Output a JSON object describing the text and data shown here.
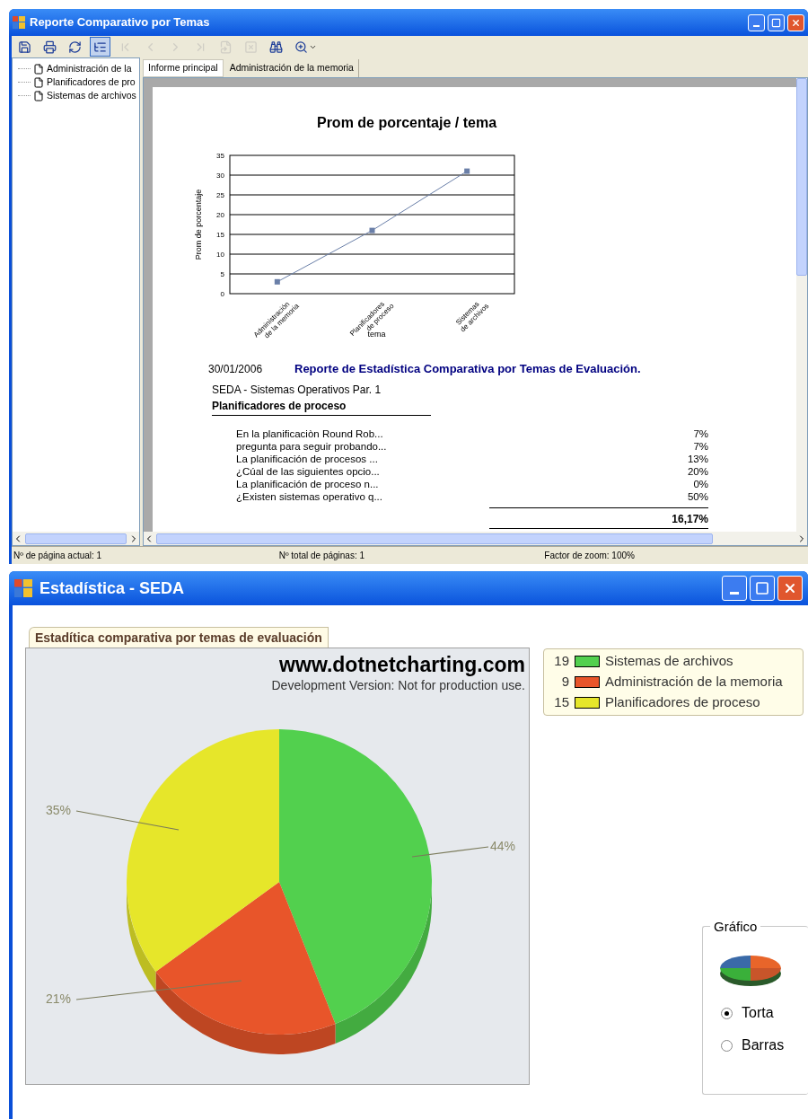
{
  "report_window": {
    "title": "Reporte Comparativo por Temas",
    "toolbar": [
      {
        "kind": "export",
        "disabled": false,
        "selected": false
      },
      {
        "kind": "print",
        "disabled": false,
        "selected": false
      },
      {
        "kind": "refresh",
        "disabled": false,
        "selected": false
      },
      {
        "kind": "tree",
        "disabled": false,
        "selected": true
      },
      {
        "kind": "first",
        "disabled": true,
        "selected": false
      },
      {
        "kind": "previous",
        "disabled": true,
        "selected": false
      },
      {
        "kind": "next",
        "disabled": true,
        "selected": false
      },
      {
        "kind": "last",
        "disabled": true,
        "selected": false
      },
      {
        "kind": "goto",
        "disabled": true,
        "selected": false
      },
      {
        "kind": "stop",
        "disabled": true,
        "selected": false
      },
      {
        "kind": "find",
        "disabled": false,
        "selected": false
      },
      {
        "kind": "zoom",
        "disabled": false,
        "selected": false
      }
    ],
    "tree": [
      {
        "label": "Administración de la"
      },
      {
        "label": "Planificadores de pro"
      },
      {
        "label": "Sistemas de archivos"
      }
    ],
    "tabs": [
      {
        "label": "Informe principal",
        "selected": true
      },
      {
        "label": "Administración de la memoria",
        "selected": false
      }
    ],
    "page": {
      "chart_data": {
        "type": "line",
        "title": "Prom de porcentaje / tema",
        "xlabel": "tema",
        "ylabel": "Prom de porcentaje",
        "categories": [
          "Administración de la memoria",
          "Planificadores de proceso",
          "Sistemas de archivos"
        ],
        "series": [
          {
            "color": "#6a7fa8",
            "marker": "square",
            "values": [
              3,
              16,
              31
            ]
          }
        ],
        "grid": true,
        "ylim": [
          0,
          35
        ],
        "yticks": [
          0,
          5,
          10,
          15,
          20,
          25,
          30,
          35
        ]
      },
      "date": "30/01/2006",
      "heading": "Reporte de Estadística Comparativa  por Temas de Evaluación.",
      "subtitle": "SEDA  - Sistemas Operativos Par. 1",
      "group": "Planificadores de proceso",
      "rows": [
        {
          "question": "En la planificaciòn Round Rob...",
          "percent": "7%"
        },
        {
          "question": "pregunta para seguir probando...",
          "percent": "7%"
        },
        {
          "question": "La planificación de procesos ...",
          "percent": "13%"
        },
        {
          "question": "¿Cúal de las siguientes opcio...",
          "percent": "20%"
        },
        {
          "question": "La planificación de proceso n...",
          "percent": "0%"
        },
        {
          "question": "¿Existen sistemas operativo q...",
          "percent": "50%"
        }
      ],
      "total": "16,17%"
    },
    "status_bar": [
      "Nº de página actual: 1",
      "Nº total de páginas: 1",
      "Factor de zoom: 100%"
    ]
  },
  "stats_window": {
    "title": "Estadística - SEDA",
    "chart_tab": "Estadítica comparativa por temas de evaluación",
    "watermark": {
      "site": "www.dotnetcharting.com",
      "note": "Development Version: Not for production use."
    },
    "chart_data": {
      "type": "pie",
      "values": [
        44,
        21,
        35
      ],
      "value_labels": [
        "44%",
        "21%",
        "35%"
      ]
    },
    "legend": [
      {
        "count": "19",
        "label": "Sistemas de archivos",
        "color": "#52d04e"
      },
      {
        "count": "9",
        "label": "Administración de la memoria",
        "color": "#e8552a"
      },
      {
        "count": "15",
        "label": "Planificadores de proceso",
        "color": "#e6e62a"
      }
    ],
    "chart_type": {
      "title": "Gráfico",
      "options": [
        {
          "label": "Torta",
          "selected": true
        },
        {
          "label": "Barras",
          "selected": false
        }
      ]
    }
  }
}
